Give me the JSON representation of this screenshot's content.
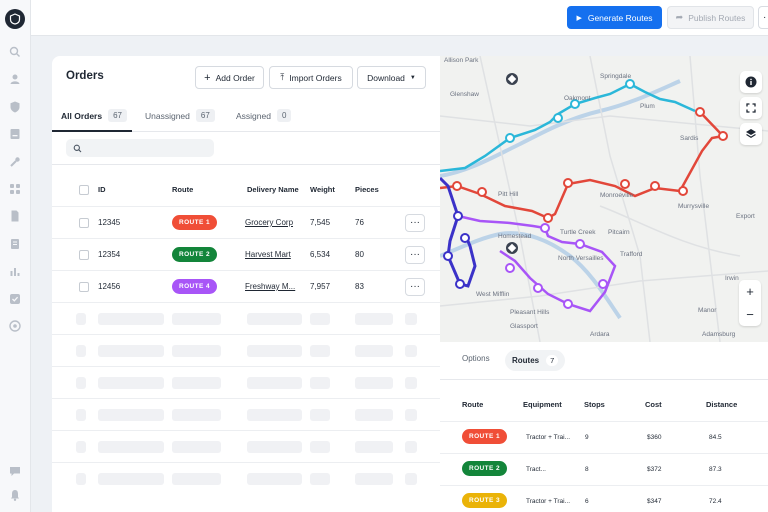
{
  "toolbar": {
    "generate_label": "Generate Routes",
    "publish_label": "Publish Routes",
    "more_label": "·"
  },
  "orders": {
    "title": "Orders",
    "add_label": "Add Order",
    "import_label": "Import Orders",
    "download_label": "Download",
    "tabs": [
      {
        "label": "All Orders",
        "count": "67"
      },
      {
        "label": "Unassigned",
        "count": "67"
      },
      {
        "label": "Assigned",
        "count": "0"
      }
    ],
    "search_placeholder": "",
    "columns": [
      "ID",
      "Route",
      "Delivery Name",
      "Weight",
      "Pieces"
    ],
    "rows": [
      {
        "id": "12345",
        "route": "ROUTE 1",
        "route_color": "#f04e37",
        "name": "Grocery Corp",
        "weight": "7,545",
        "pieces": "76"
      },
      {
        "id": "12354",
        "route": "ROUTE 2",
        "route_color": "#13853a",
        "name": "Harvest Mart",
        "weight": "6,534",
        "pieces": "80"
      },
      {
        "id": "12456",
        "route": "ROUTE 4",
        "route_color": "#a855f7",
        "name": "Freshway M...",
        "weight": "7,957",
        "pieces": "83"
      }
    ],
    "row_action": "···"
  },
  "map": {
    "labels": [
      "Allison Park",
      "Glenshaw",
      "Springdale",
      "Oakmont",
      "Plum",
      "Sardis",
      "Pitt Hill",
      "Monroeville",
      "Murrysville",
      "Export",
      "Homestead",
      "Turtle Creek",
      "Pitcairn",
      "Trafford",
      "North Versailles",
      "West Mifflin",
      "Pleasant Hills",
      "Glassport",
      "Irwin",
      "Manor",
      "Adamsburg",
      "Ardara"
    ],
    "zoom_in": "+",
    "zoom_out": "−"
  },
  "routes_panel": {
    "tabs": [
      {
        "label": "Options"
      },
      {
        "label": "Routes",
        "count": "7"
      }
    ],
    "columns": [
      "Route",
      "Equipment",
      "Stops",
      "Cost",
      "Distance"
    ],
    "rows": [
      {
        "route": "ROUTE 1",
        "route_color": "#f04e37",
        "equipment": "Tractor + Trai...",
        "stops": "9",
        "cost": "$360",
        "distance": "84.5"
      },
      {
        "route": "ROUTE 2",
        "route_color": "#13853a",
        "equipment": "Tract...",
        "stops": "8",
        "cost": "$372",
        "distance": "87.3"
      },
      {
        "route": "ROUTE 3",
        "route_color": "#eab308",
        "equipment": "Tractor + Trai...",
        "stops": "6",
        "cost": "$347",
        "distance": "72.4"
      }
    ]
  }
}
